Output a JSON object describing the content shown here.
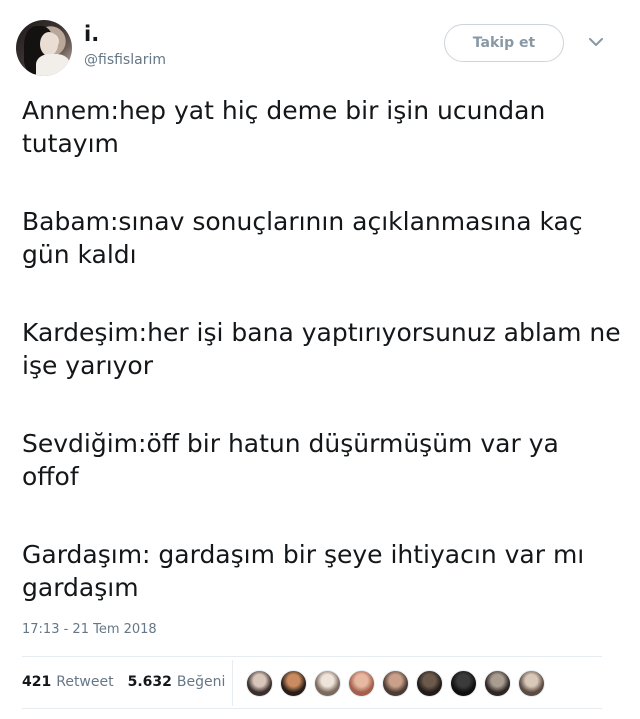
{
  "profile": {
    "name": "i.",
    "handle": "@fisfislarim",
    "follow_label": "Takip et"
  },
  "tweet": {
    "paragraphs": [
      "Annem:hep yat hiç deme bir işin ucundan tutayım",
      "Babam:sınav sonuçlarının açıklanmasına kaç gün kaldı",
      "Kardeşim:her işi bana yaptırıyorsunuz ablam ne işe yarıyor",
      "Sevdiğim:öff bir hatun düşürmüşüm var ya offof",
      "Gardaşım: gardaşım bir şeye ihtiyacın var mı gardaşım"
    ],
    "timestamp": "17:13 - 21 Tem 2018"
  },
  "stats": {
    "retweet_count": "421",
    "retweet_label": "Retweet",
    "like_count": "5.632",
    "like_label": "Beğeni"
  },
  "likers": [
    {
      "icon": "liker-avatar",
      "color_a": "#d9c6bb",
      "color_b": "#3a2f2c"
    },
    {
      "icon": "liker-avatar",
      "color_a": "#c98b5f",
      "color_b": "#2a1d18"
    },
    {
      "icon": "liker-avatar",
      "color_a": "#efe4da",
      "color_b": "#7b6a5e"
    },
    {
      "icon": "liker-avatar",
      "color_a": "#e7b9a2",
      "color_b": "#a35f4b"
    },
    {
      "icon": "liker-avatar",
      "color_a": "#caa08a",
      "color_b": "#4c3b33"
    },
    {
      "icon": "liker-avatar",
      "color_a": "#6b5a4c",
      "color_b": "#231b17"
    },
    {
      "icon": "liker-avatar",
      "color_a": "#3b3b3b",
      "color_b": "#0f0f0f"
    },
    {
      "icon": "liker-avatar",
      "color_a": "#a99d92",
      "color_b": "#2e2622"
    },
    {
      "icon": "liker-avatar",
      "color_a": "#d7c8b9",
      "color_b": "#5b4b42"
    }
  ],
  "colors": {
    "text": "#14171a",
    "muted": "#657786",
    "border": "#e6ecf0"
  }
}
